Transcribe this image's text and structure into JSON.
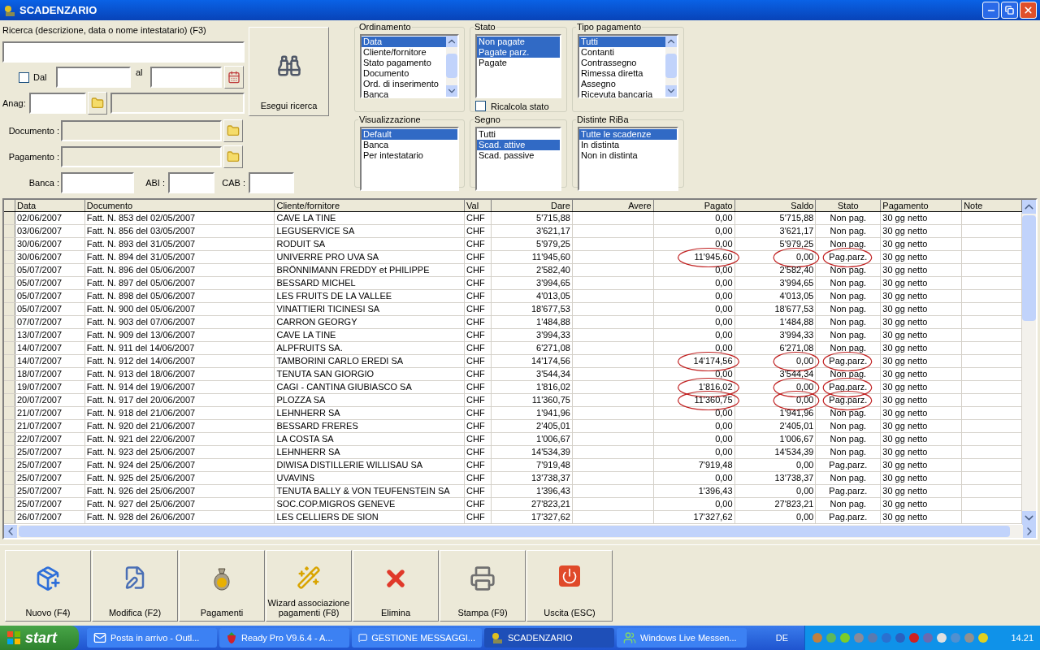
{
  "window": {
    "title": "SCADENZARIO"
  },
  "search": {
    "label": "Ricerca (descrizione, data o nome intestatario) (F3)",
    "dal_label": "Dal",
    "dal_checked": false,
    "al_label": "al",
    "anag_label": "Anag:",
    "documento_label": "Documento :",
    "pagamento_label": "Pagamento :",
    "banca_label": "Banca :",
    "abi_label": "ABI :",
    "cab_label": "CAB :",
    "button": "Esegui ricerca"
  },
  "filters": [
    {
      "title": "Ordinamento",
      "items": [
        {
          "label": "Data",
          "selected": true
        },
        {
          "label": "Cliente/fornitore",
          "selected": false
        },
        {
          "label": "Stato pagamento",
          "selected": false
        },
        {
          "label": "Documento",
          "selected": false
        },
        {
          "label": "Ord. di inserimento",
          "selected": false
        },
        {
          "label": "Banca",
          "selected": false
        }
      ]
    },
    {
      "title": "Stato",
      "items": [
        {
          "label": "Non pagate",
          "selected": true
        },
        {
          "label": "Pagate parz.",
          "selected": true
        },
        {
          "label": "Pagate",
          "selected": false
        }
      ]
    },
    {
      "title": "Tipo pagamento",
      "items": [
        {
          "label": "Tutti",
          "selected": true
        },
        {
          "label": "Contanti",
          "selected": false
        },
        {
          "label": "Contrassegno",
          "selected": false
        },
        {
          "label": "Rimessa diretta",
          "selected": false
        },
        {
          "label": "Assegno",
          "selected": false
        },
        {
          "label": "Ricevuta bancaria",
          "selected": false
        }
      ]
    },
    {
      "title": "Visualizzazione",
      "items": [
        {
          "label": "Default",
          "selected": true
        },
        {
          "label": "Banca",
          "selected": false
        },
        {
          "label": "Per intestatario",
          "selected": false
        }
      ]
    },
    {
      "title": "Segno",
      "items": [
        {
          "label": "Tutti",
          "selected": false
        },
        {
          "label": "Scad. attive",
          "selected": true
        },
        {
          "label": "Scad. passive",
          "selected": false
        }
      ]
    },
    {
      "title": "Distinte RiBa",
      "items": [
        {
          "label": "Tutte le scadenze",
          "selected": true
        },
        {
          "label": "In distinta",
          "selected": false
        },
        {
          "label": "Non in distinta",
          "selected": false
        }
      ]
    }
  ],
  "ricalcola": {
    "label": "Ricalcola stato",
    "checked": false
  },
  "table": {
    "columns": [
      "Data",
      "Documento",
      "Cliente/fornitore",
      "Val",
      "Dare",
      "Avere",
      "Pagato",
      "Saldo",
      "Stato",
      "Pagamento",
      "Note"
    ],
    "rows": [
      {
        "cells": [
          "02/06/2007",
          "Fatt. N. 853 del 02/05/2007",
          "CAVE LA TINE",
          "CHF",
          "5'715,88",
          "",
          "0,00",
          "5'715,88",
          "Non pag.",
          "30 gg netto",
          ""
        ],
        "circled": false
      },
      {
        "cells": [
          "03/06/2007",
          "Fatt. N. 856 del 03/05/2007",
          "LEGUSERVICE SA",
          "CHF",
          "3'621,17",
          "",
          "0,00",
          "3'621,17",
          "Non pag.",
          "30 gg netto",
          ""
        ],
        "circled": false
      },
      {
        "cells": [
          "30/06/2007",
          "Fatt. N. 893 del 31/05/2007",
          "RODUIT SA",
          "CHF",
          "5'979,25",
          "",
          "0,00",
          "5'979,25",
          "Non pag.",
          "30 gg netto",
          ""
        ],
        "circled": false
      },
      {
        "cells": [
          "30/06/2007",
          "Fatt. N. 894 del 31/05/2007",
          "UNIVERRE PRO UVA SA",
          "CHF",
          "11'945,60",
          "",
          "11'945,60",
          "0,00",
          "Pag.parz.",
          "30 gg netto",
          ""
        ],
        "circled": true
      },
      {
        "cells": [
          "05/07/2007",
          "Fatt. N. 896 del 05/06/2007",
          "BRÖNNIMANN FREDDY et PHILIPPE",
          "CHF",
          "2'582,40",
          "",
          "0,00",
          "2'582,40",
          "Non pag.",
          "30 gg netto",
          ""
        ],
        "circled": false
      },
      {
        "cells": [
          "05/07/2007",
          "Fatt. N. 897 del 05/06/2007",
          "BESSARD MICHEL",
          "CHF",
          "3'994,65",
          "",
          "0,00",
          "3'994,65",
          "Non pag.",
          "30 gg netto",
          ""
        ],
        "circled": false
      },
      {
        "cells": [
          "05/07/2007",
          "Fatt. N. 898 del 05/06/2007",
          "LES FRUITS DE LA VALLEE",
          "CHF",
          "4'013,05",
          "",
          "0,00",
          "4'013,05",
          "Non pag.",
          "30 gg netto",
          ""
        ],
        "circled": false
      },
      {
        "cells": [
          "05/07/2007",
          "Fatt. N. 900 del 05/06/2007",
          "VINATTIERI TICINESI SA",
          "CHF",
          "18'677,53",
          "",
          "0,00",
          "18'677,53",
          "Non pag.",
          "30 gg netto",
          ""
        ],
        "circled": false
      },
      {
        "cells": [
          "07/07/2007",
          "Fatt. N. 903 del 07/06/2007",
          "CARRON GEORGY",
          "CHF",
          "1'484,88",
          "",
          "0,00",
          "1'484,88",
          "Non pag.",
          "30 gg netto",
          ""
        ],
        "circled": false
      },
      {
        "cells": [
          "13/07/2007",
          "Fatt. N. 909 del 13/06/2007",
          "CAVE LA TINE",
          "CHF",
          "3'994,33",
          "",
          "0,00",
          "3'994,33",
          "Non pag.",
          "30 gg netto",
          ""
        ],
        "circled": false
      },
      {
        "cells": [
          "14/07/2007",
          "Fatt. N. 911 del 14/06/2007",
          "ALPFRUITS SA.",
          "CHF",
          "6'271,08",
          "",
          "0,00",
          "6'271,08",
          "Non pag.",
          "30 gg netto",
          ""
        ],
        "circled": false
      },
      {
        "cells": [
          "14/07/2007",
          "Fatt. N. 912 del 14/06/2007",
          "TAMBORINI CARLO EREDI SA",
          "CHF",
          "14'174,56",
          "",
          "14'174,56",
          "0,00",
          "Pag.parz.",
          "30 gg netto",
          ""
        ],
        "circled": true
      },
      {
        "cells": [
          "18/07/2007",
          "Fatt. N. 913 del 18/06/2007",
          "TENUTA SAN GIORGIO",
          "CHF",
          "3'544,34",
          "",
          "0,00",
          "3'544,34",
          "Non pag.",
          "30 gg netto",
          ""
        ],
        "circled": false
      },
      {
        "cells": [
          "19/07/2007",
          "Fatt. N. 914 del 19/06/2007",
          "CAGI - CANTINA GIUBIASCO SA",
          "CHF",
          "1'816,02",
          "",
          "1'816,02",
          "0,00",
          "Pag.parz.",
          "30 gg netto",
          ""
        ],
        "circled": true
      },
      {
        "cells": [
          "20/07/2007",
          "Fatt. N. 917 del 20/06/2007",
          "PLOZZA SA",
          "CHF",
          "11'360,75",
          "",
          "11'360,75",
          "0,00",
          "Pag.parz.",
          "30 gg netto",
          ""
        ],
        "circled": true
      },
      {
        "cells": [
          "21/07/2007",
          "Fatt. N. 918 del 21/06/2007",
          "LEHNHERR SA",
          "CHF",
          "1'941,96",
          "",
          "0,00",
          "1'941,96",
          "Non pag.",
          "30 gg netto",
          ""
        ],
        "circled": false
      },
      {
        "cells": [
          "21/07/2007",
          "Fatt. N. 920 del 21/06/2007",
          "BESSARD FRERES",
          "CHF",
          "2'405,01",
          "",
          "0,00",
          "2'405,01",
          "Non pag.",
          "30 gg netto",
          ""
        ],
        "circled": false
      },
      {
        "cells": [
          "22/07/2007",
          "Fatt. N. 921 del 22/06/2007",
          "LA COSTA SA",
          "CHF",
          "1'006,67",
          "",
          "0,00",
          "1'006,67",
          "Non pag.",
          "30 gg netto",
          ""
        ],
        "circled": false
      },
      {
        "cells": [
          "25/07/2007",
          "Fatt. N. 923 del 25/06/2007",
          "LEHNHERR SA",
          "CHF",
          "14'534,39",
          "",
          "0,00",
          "14'534,39",
          "Non pag.",
          "30 gg netto",
          ""
        ],
        "circled": false
      },
      {
        "cells": [
          "25/07/2007",
          "Fatt. N. 924 del 25/06/2007",
          "DIWISA DISTILLERIE WILLISAU SA",
          "CHF",
          "7'919,48",
          "",
          "7'919,48",
          "0,00",
          "Pag.parz.",
          "30 gg netto",
          ""
        ],
        "circled": false
      },
      {
        "cells": [
          "25/07/2007",
          "Fatt. N. 925 del 25/06/2007",
          "UVAVINS",
          "CHF",
          "13'738,37",
          "",
          "0,00",
          "13'738,37",
          "Non pag.",
          "30 gg netto",
          ""
        ],
        "circled": false
      },
      {
        "cells": [
          "25/07/2007",
          "Fatt. N. 926 del 25/06/2007",
          "TENUTA BALLY & VON TEUFENSTEIN SA",
          "CHF",
          "1'396,43",
          "",
          "1'396,43",
          "0,00",
          "Pag.parz.",
          "30 gg netto",
          ""
        ],
        "circled": false
      },
      {
        "cells": [
          "25/07/2007",
          "Fatt. N. 927 del 25/06/2007",
          "SOC.COP.MIGROS GENEVE",
          "CHF",
          "27'823,21",
          "",
          "0,00",
          "27'823,21",
          "Non pag.",
          "30 gg netto",
          ""
        ],
        "circled": false
      },
      {
        "cells": [
          "26/07/2007",
          "Fatt. N. 928 del 26/06/2007",
          "LES CELLIERS DE SION",
          "CHF",
          "17'327,62",
          "",
          "17'327,62",
          "0,00",
          "Pag.parz.",
          "30 gg netto",
          ""
        ],
        "circled": false
      }
    ]
  },
  "buttons": [
    {
      "label": "Nuovo (F4)"
    },
    {
      "label": "Modifica (F2)"
    },
    {
      "label": "Pagamenti"
    },
    {
      "label": "Wizard associazione pagamenti (F8)"
    },
    {
      "label": "Elimina"
    },
    {
      "label": "Stampa (F9)"
    },
    {
      "label": "Uscita (ESC)"
    }
  ],
  "taskbar": {
    "start": "start",
    "items": [
      {
        "label": "Posta in arrivo - Outl...",
        "selected": false
      },
      {
        "label": "Ready Pro V9.6.4 - A...",
        "selected": false
      },
      {
        "label": "GESTIONE MESSAGGI...",
        "selected": false
      },
      {
        "label": "SCADENZARIO",
        "selected": true
      },
      {
        "label": "Windows Live Messen...",
        "selected": false
      }
    ],
    "language": "DE",
    "clock": "14.21"
  }
}
